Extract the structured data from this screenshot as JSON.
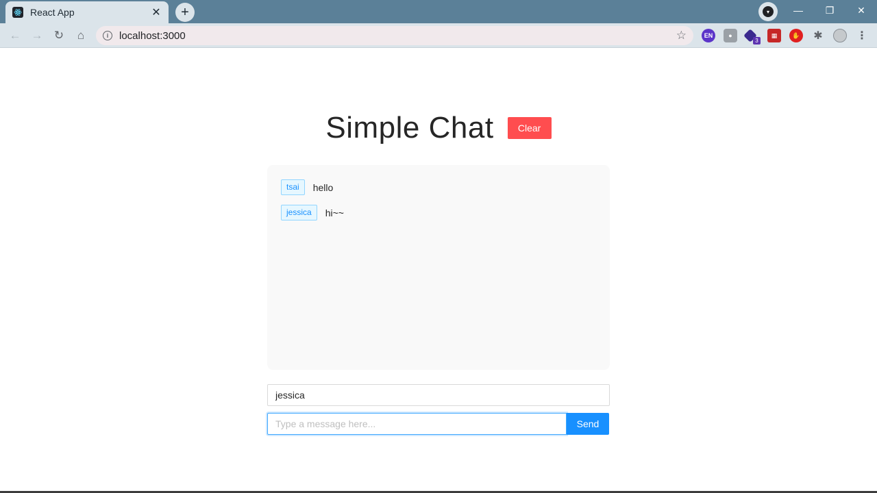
{
  "browser": {
    "tab_title": "React App",
    "tab_close": "✕",
    "new_tab": "+",
    "url": "localhost:3000",
    "star": "☆",
    "ext_en": "EN",
    "ext_badge_count": "3",
    "window_controls": {
      "minimize": "—",
      "restore": "❐",
      "close": "✕"
    }
  },
  "app": {
    "title": "Simple Chat",
    "clear_label": "Clear",
    "messages": [
      {
        "user": "tsai",
        "text": "hello"
      },
      {
        "user": "jessica",
        "text": "hi~~"
      }
    ],
    "name_value": "jessica",
    "message_placeholder": "Type a message here...",
    "send_label": "Send"
  },
  "colors": {
    "clear_button": "#ff4d4f",
    "send_button": "#1890ff",
    "tag_text": "#1890ff",
    "chrome_frame": "#5b8098"
  }
}
